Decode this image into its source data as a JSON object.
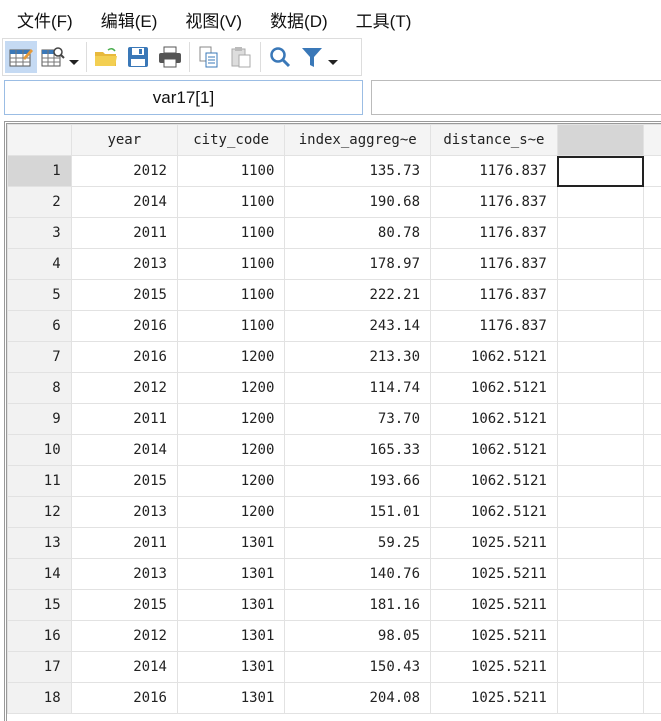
{
  "menu": [
    "文件(F)",
    "编辑(E)",
    "视图(V)",
    "数据(D)",
    "工具(T)"
  ],
  "toolbar": {
    "icons": [
      "data-editor-edit-icon",
      "data-browser-icon",
      "open-folder-icon",
      "save-icon",
      "print-icon",
      "copy-icon",
      "paste-icon",
      "find-icon",
      "filter-icon"
    ],
    "accent": "#3a78b8"
  },
  "cell_name": "var17[1]",
  "cell_value": "",
  "columns": [
    "year",
    "city_code",
    "index_aggreg~e",
    "distance_s~e",
    ""
  ],
  "rows": [
    [
      "1",
      "2012",
      "1100",
      "135.73",
      "1176.837"
    ],
    [
      "2",
      "2014",
      "1100",
      "190.68",
      "1176.837"
    ],
    [
      "3",
      "2011",
      "1100",
      "80.78",
      "1176.837"
    ],
    [
      "4",
      "2013",
      "1100",
      "178.97",
      "1176.837"
    ],
    [
      "5",
      "2015",
      "1100",
      "222.21",
      "1176.837"
    ],
    [
      "6",
      "2016",
      "1100",
      "243.14",
      "1176.837"
    ],
    [
      "7",
      "2016",
      "1200",
      "213.30",
      "1062.5121"
    ],
    [
      "8",
      "2012",
      "1200",
      "114.74",
      "1062.5121"
    ],
    [
      "9",
      "2011",
      "1200",
      "73.70",
      "1062.5121"
    ],
    [
      "10",
      "2014",
      "1200",
      "165.33",
      "1062.5121"
    ],
    [
      "11",
      "2015",
      "1200",
      "193.66",
      "1062.5121"
    ],
    [
      "12",
      "2013",
      "1200",
      "151.01",
      "1062.5121"
    ],
    [
      "13",
      "2011",
      "1301",
      "59.25",
      "1025.5211"
    ],
    [
      "14",
      "2013",
      "1301",
      "140.76",
      "1025.5211"
    ],
    [
      "15",
      "2015",
      "1301",
      "181.16",
      "1025.5211"
    ],
    [
      "16",
      "2012",
      "1301",
      "98.05",
      "1025.5211"
    ],
    [
      "17",
      "2014",
      "1301",
      "150.43",
      "1025.5211"
    ],
    [
      "18",
      "2016",
      "1301",
      "204.08",
      "1025.5211"
    ]
  ]
}
